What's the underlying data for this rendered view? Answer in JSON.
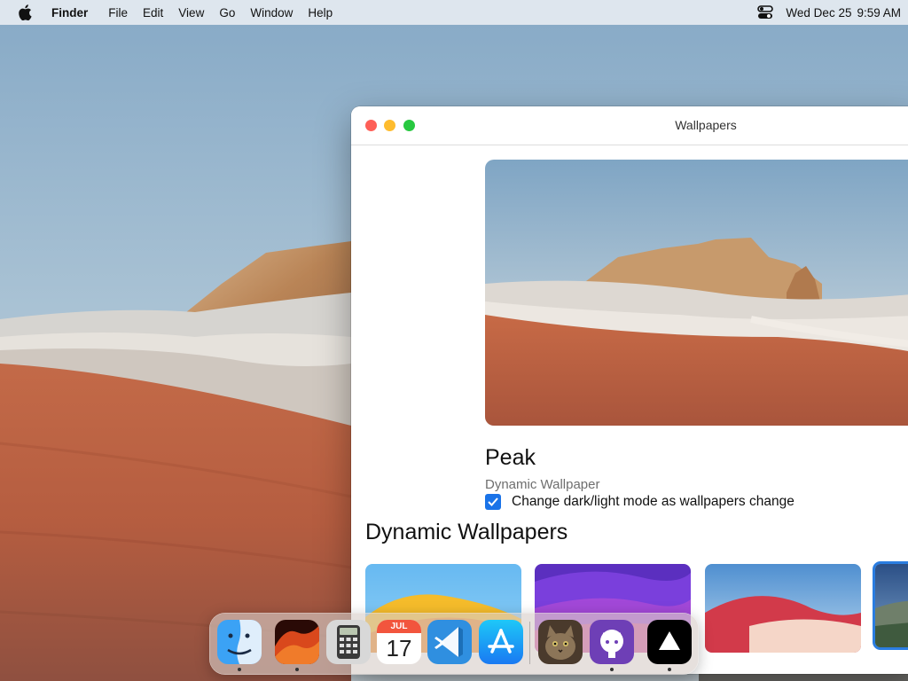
{
  "menubar": {
    "app_name": "Finder",
    "menus": [
      "File",
      "Edit",
      "View",
      "Go",
      "Window",
      "Help"
    ],
    "date": "Wed Dec 25",
    "time": "9:59 AM",
    "icons": {
      "apple": "apple-logo-icon",
      "control_center": "control-center-icon"
    }
  },
  "window": {
    "title": "Wallpapers",
    "current_wallpaper": {
      "name": "Peak",
      "kind": "Dynamic Wallpaper",
      "option_label": "Change dark/light mode as wallpapers change",
      "option_checked": true
    },
    "section_title": "Dynamic Wallpapers",
    "thumbnails": [
      "ventura-yellow",
      "monterey-purple",
      "big-sur-red",
      "peak-selected"
    ]
  },
  "dock": {
    "apps": [
      {
        "name": "Finder",
        "running": true
      },
      {
        "name": "macOS Ventura",
        "running": true
      },
      {
        "name": "Calculator",
        "running": false
      },
      {
        "name": "Calendar",
        "running": false,
        "month": "JUL",
        "day": "17"
      },
      {
        "name": "Visual Studio Code",
        "running": false
      },
      {
        "name": "App Store",
        "running": false
      },
      {
        "name": "Cat Photo",
        "running": false
      },
      {
        "name": "GitHub",
        "running": true
      },
      {
        "name": "Vercel",
        "running": true
      }
    ]
  },
  "colors": {
    "accent": "#1a73e8",
    "traffic_close": "#fe5f57",
    "traffic_min": "#febc2e",
    "traffic_max": "#28c840"
  }
}
